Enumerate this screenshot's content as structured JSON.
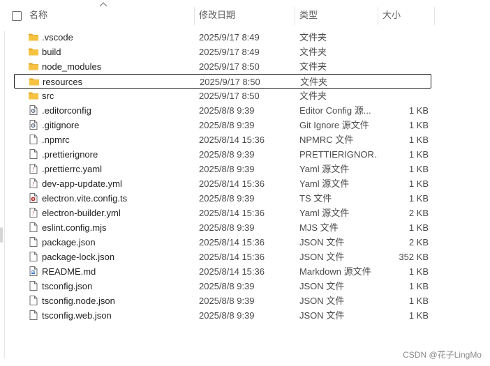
{
  "columns": {
    "name": "名称",
    "date": "修改日期",
    "type": "类型",
    "size": "大小"
  },
  "files": [
    {
      "name": ".vscode",
      "date": "2025/9/17 8:49",
      "type": "文件夹",
      "size": "",
      "icon": "folder-icon"
    },
    {
      "name": "build",
      "date": "2025/9/17 8:49",
      "type": "文件夹",
      "size": "",
      "icon": "folder-icon"
    },
    {
      "name": "node_modules",
      "date": "2025/9/17 8:50",
      "type": "文件夹",
      "size": "",
      "icon": "folder-icon"
    },
    {
      "name": "resources",
      "date": "2025/9/17 8:50",
      "type": "文件夹",
      "size": "",
      "icon": "folder-icon",
      "selected": true
    },
    {
      "name": "src",
      "date": "2025/9/17 8:50",
      "type": "文件夹",
      "size": "",
      "icon": "folder-icon"
    },
    {
      "name": ".editorconfig",
      "date": "2025/8/8 9:39",
      "type": "Editor Config 源...",
      "size": "1 KB",
      "icon": "gear-file-icon"
    },
    {
      "name": ".gitignore",
      "date": "2025/8/8 9:39",
      "type": "Git Ignore 源文件",
      "size": "1 KB",
      "icon": "gear-file-icon"
    },
    {
      "name": ".npmrc",
      "date": "2025/8/14 15:36",
      "type": "NPMRC 文件",
      "size": "1 KB",
      "icon": "file-icon"
    },
    {
      "name": ".prettierignore",
      "date": "2025/8/8 9:39",
      "type": "PRETTIERIGNOR...",
      "size": "1 KB",
      "icon": "file-icon"
    },
    {
      "name": ".prettierrc.yaml",
      "date": "2025/8/8 9:39",
      "type": "Yaml 源文件",
      "size": "1 KB",
      "icon": "yaml-file-icon"
    },
    {
      "name": "dev-app-update.yml",
      "date": "2025/8/14 15:36",
      "type": "Yaml 源文件",
      "size": "1 KB",
      "icon": "yaml-file-icon"
    },
    {
      "name": "electron.vite.config.ts",
      "date": "2025/8/8 9:39",
      "type": "TS 文件",
      "size": "1 KB",
      "icon": "ts-file-icon"
    },
    {
      "name": "electron-builder.yml",
      "date": "2025/8/14 15:36",
      "type": "Yaml 源文件",
      "size": "2 KB",
      "icon": "yaml-file-icon"
    },
    {
      "name": "eslint.config.mjs",
      "date": "2025/8/8 9:39",
      "type": "MJS 文件",
      "size": "1 KB",
      "icon": "file-icon"
    },
    {
      "name": "package.json",
      "date": "2025/8/14 15:36",
      "type": "JSON 文件",
      "size": "2 KB",
      "icon": "file-icon"
    },
    {
      "name": "package-lock.json",
      "date": "2025/8/14 15:36",
      "type": "JSON 文件",
      "size": "352 KB",
      "icon": "file-icon"
    },
    {
      "name": "README.md",
      "date": "2025/8/14 15:36",
      "type": "Markdown 源文件",
      "size": "1 KB",
      "icon": "markdown-file-icon"
    },
    {
      "name": "tsconfig.json",
      "date": "2025/8/8 9:39",
      "type": "JSON 文件",
      "size": "1 KB",
      "icon": "file-icon"
    },
    {
      "name": "tsconfig.node.json",
      "date": "2025/8/8 9:39",
      "type": "JSON 文件",
      "size": "1 KB",
      "icon": "file-icon"
    },
    {
      "name": "tsconfig.web.json",
      "date": "2025/8/8 9:39",
      "type": "JSON 文件",
      "size": "1 KB",
      "icon": "file-icon"
    }
  ],
  "watermark": "CSDN @花子LingMo",
  "colors": {
    "folder": "#f5c242",
    "folder_dark": "#e0a526",
    "selection_border": "#1f1f1f"
  }
}
